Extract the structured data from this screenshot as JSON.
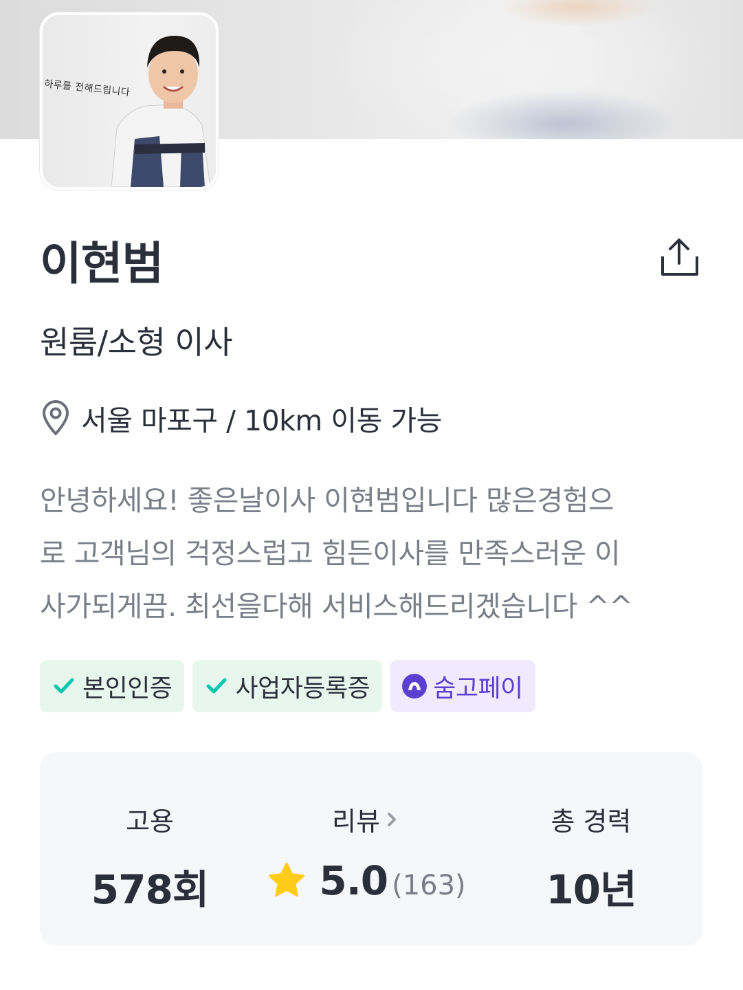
{
  "profile": {
    "name": "이현범",
    "category": "원룸/소형 이사",
    "location": "서울 마포구 / 10km 이동 가능",
    "avatar_caption": "하루를 전해드립니다",
    "intro_lines": [
      "안녕하세요! 좋은날이사 이현범입니다 많은경험으",
      "로 고객님의 걱정스럽고 힘든이사를 만족스러운 이",
      "사가되게끔. 최선을다해 서비스해드리겠습니다 ^^"
    ]
  },
  "icons": {
    "share": "share-upload-icon",
    "location": "map-pin-icon",
    "check": "check-icon",
    "pay": "soomgo-pay-logo-icon",
    "star": "star-icon",
    "chevron": "chevron-right-icon"
  },
  "badges": [
    {
      "label": "본인인증",
      "type": "verified"
    },
    {
      "label": "사업자등록증",
      "type": "verified"
    },
    {
      "label": "숨고페이",
      "type": "pay"
    }
  ],
  "stats": {
    "hire": {
      "label": "고용",
      "value": "578회"
    },
    "review": {
      "label": "리뷰",
      "rating": "5.0",
      "count": "(163)"
    },
    "career": {
      "label": "총 경력",
      "value": "10년"
    }
  },
  "colors": {
    "text": "#2b2f3a",
    "muted": "#7a7e87",
    "green": "#00c7ae",
    "badge_green_bg": "#e8f7ee",
    "purple": "#5b3fd1",
    "badge_purple_bg": "#efeafd",
    "star": "#ffcc1a"
  }
}
